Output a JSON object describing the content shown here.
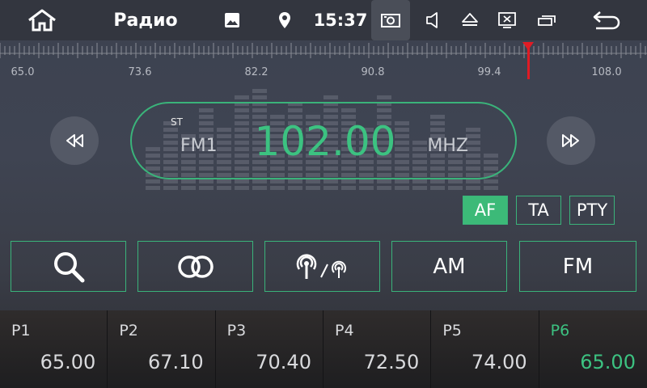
{
  "status_bar": {
    "title": "Радио",
    "clock": "15:37",
    "icons": [
      "home-icon",
      "gallery-icon",
      "location-icon",
      "screenshot-icon",
      "volume-icon",
      "eject-icon",
      "display-off-icon",
      "recents-icon",
      "back-icon"
    ]
  },
  "tuner": {
    "scale_labels": [
      "65.0",
      "73.6",
      "82.2",
      "90.8",
      "99.4",
      "108.0"
    ],
    "stereo": "ST",
    "band": "FM1",
    "frequency": "102.00",
    "unit": "MHZ",
    "range_mhz": [
      65.0,
      108.0
    ]
  },
  "options": {
    "af": "AF",
    "ta": "TA",
    "pty": "PTY",
    "af_active": true
  },
  "functions": {
    "am": "AM",
    "fm": "FM",
    "icons": [
      "search-icon",
      "stereo-icon",
      "local-dx-icon"
    ]
  },
  "presets": [
    {
      "name": "P1",
      "freq": "65.00"
    },
    {
      "name": "P2",
      "freq": "67.10"
    },
    {
      "name": "P3",
      "freq": "70.40"
    },
    {
      "name": "P4",
      "freq": "72.50"
    },
    {
      "name": "P5",
      "freq": "74.00"
    },
    {
      "name": "P6",
      "freq": "65.00"
    }
  ],
  "colors": {
    "accent": "#3cc281",
    "needle": "#e01b24",
    "status_bar": "#33363f"
  }
}
